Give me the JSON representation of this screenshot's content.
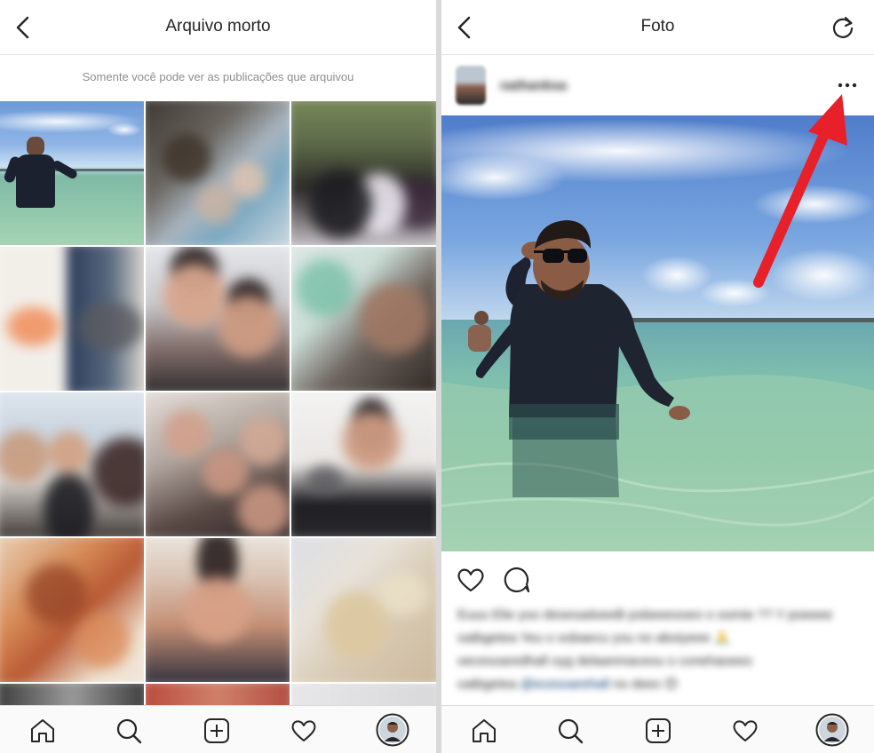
{
  "left_screen": {
    "header": {
      "title": "Arquivo morto",
      "back_icon": "chevron-left-icon"
    },
    "notice": "Somente você pode ver as publicações que arquivou",
    "grid_tiles": 12,
    "bottom_nav": [
      {
        "name": "home",
        "icon": "home-icon"
      },
      {
        "name": "search",
        "icon": "search-icon"
      },
      {
        "name": "new-post",
        "icon": "plus-square-icon"
      },
      {
        "name": "activity",
        "icon": "heart-icon"
      },
      {
        "name": "profile",
        "icon": "profile-avatar"
      }
    ]
  },
  "right_screen": {
    "header": {
      "title": "Foto",
      "back_icon": "chevron-left-icon",
      "refresh_icon": "refresh-icon"
    },
    "post": {
      "username": "nathanbsa",
      "more_icon": "more-options-icon",
      "caption_line1": "Euuu Elie yoo desesadoeeB pobeeeooeo o oomie ?? Y poeeee",
      "caption_line2": "oatbgetea Yeu o oobaecu you no aboiyeee 🙏",
      "caption_line3": "oecesoaredhall oyg delaanmaceou o conehaoeeo",
      "caption_line4": "oatbgetea",
      "caption_tag": "@ecesoarehall",
      "caption_end": "no dees 😊"
    },
    "bottom_nav": [
      {
        "name": "home",
        "icon": "home-icon"
      },
      {
        "name": "search",
        "icon": "search-icon"
      },
      {
        "name": "new-post",
        "icon": "plus-square-icon"
      },
      {
        "name": "activity",
        "icon": "heart-icon"
      },
      {
        "name": "profile",
        "icon": "profile-avatar"
      }
    ]
  },
  "annotation": {
    "arrow_color": "#e8202a",
    "points_to": "more-options-icon"
  }
}
